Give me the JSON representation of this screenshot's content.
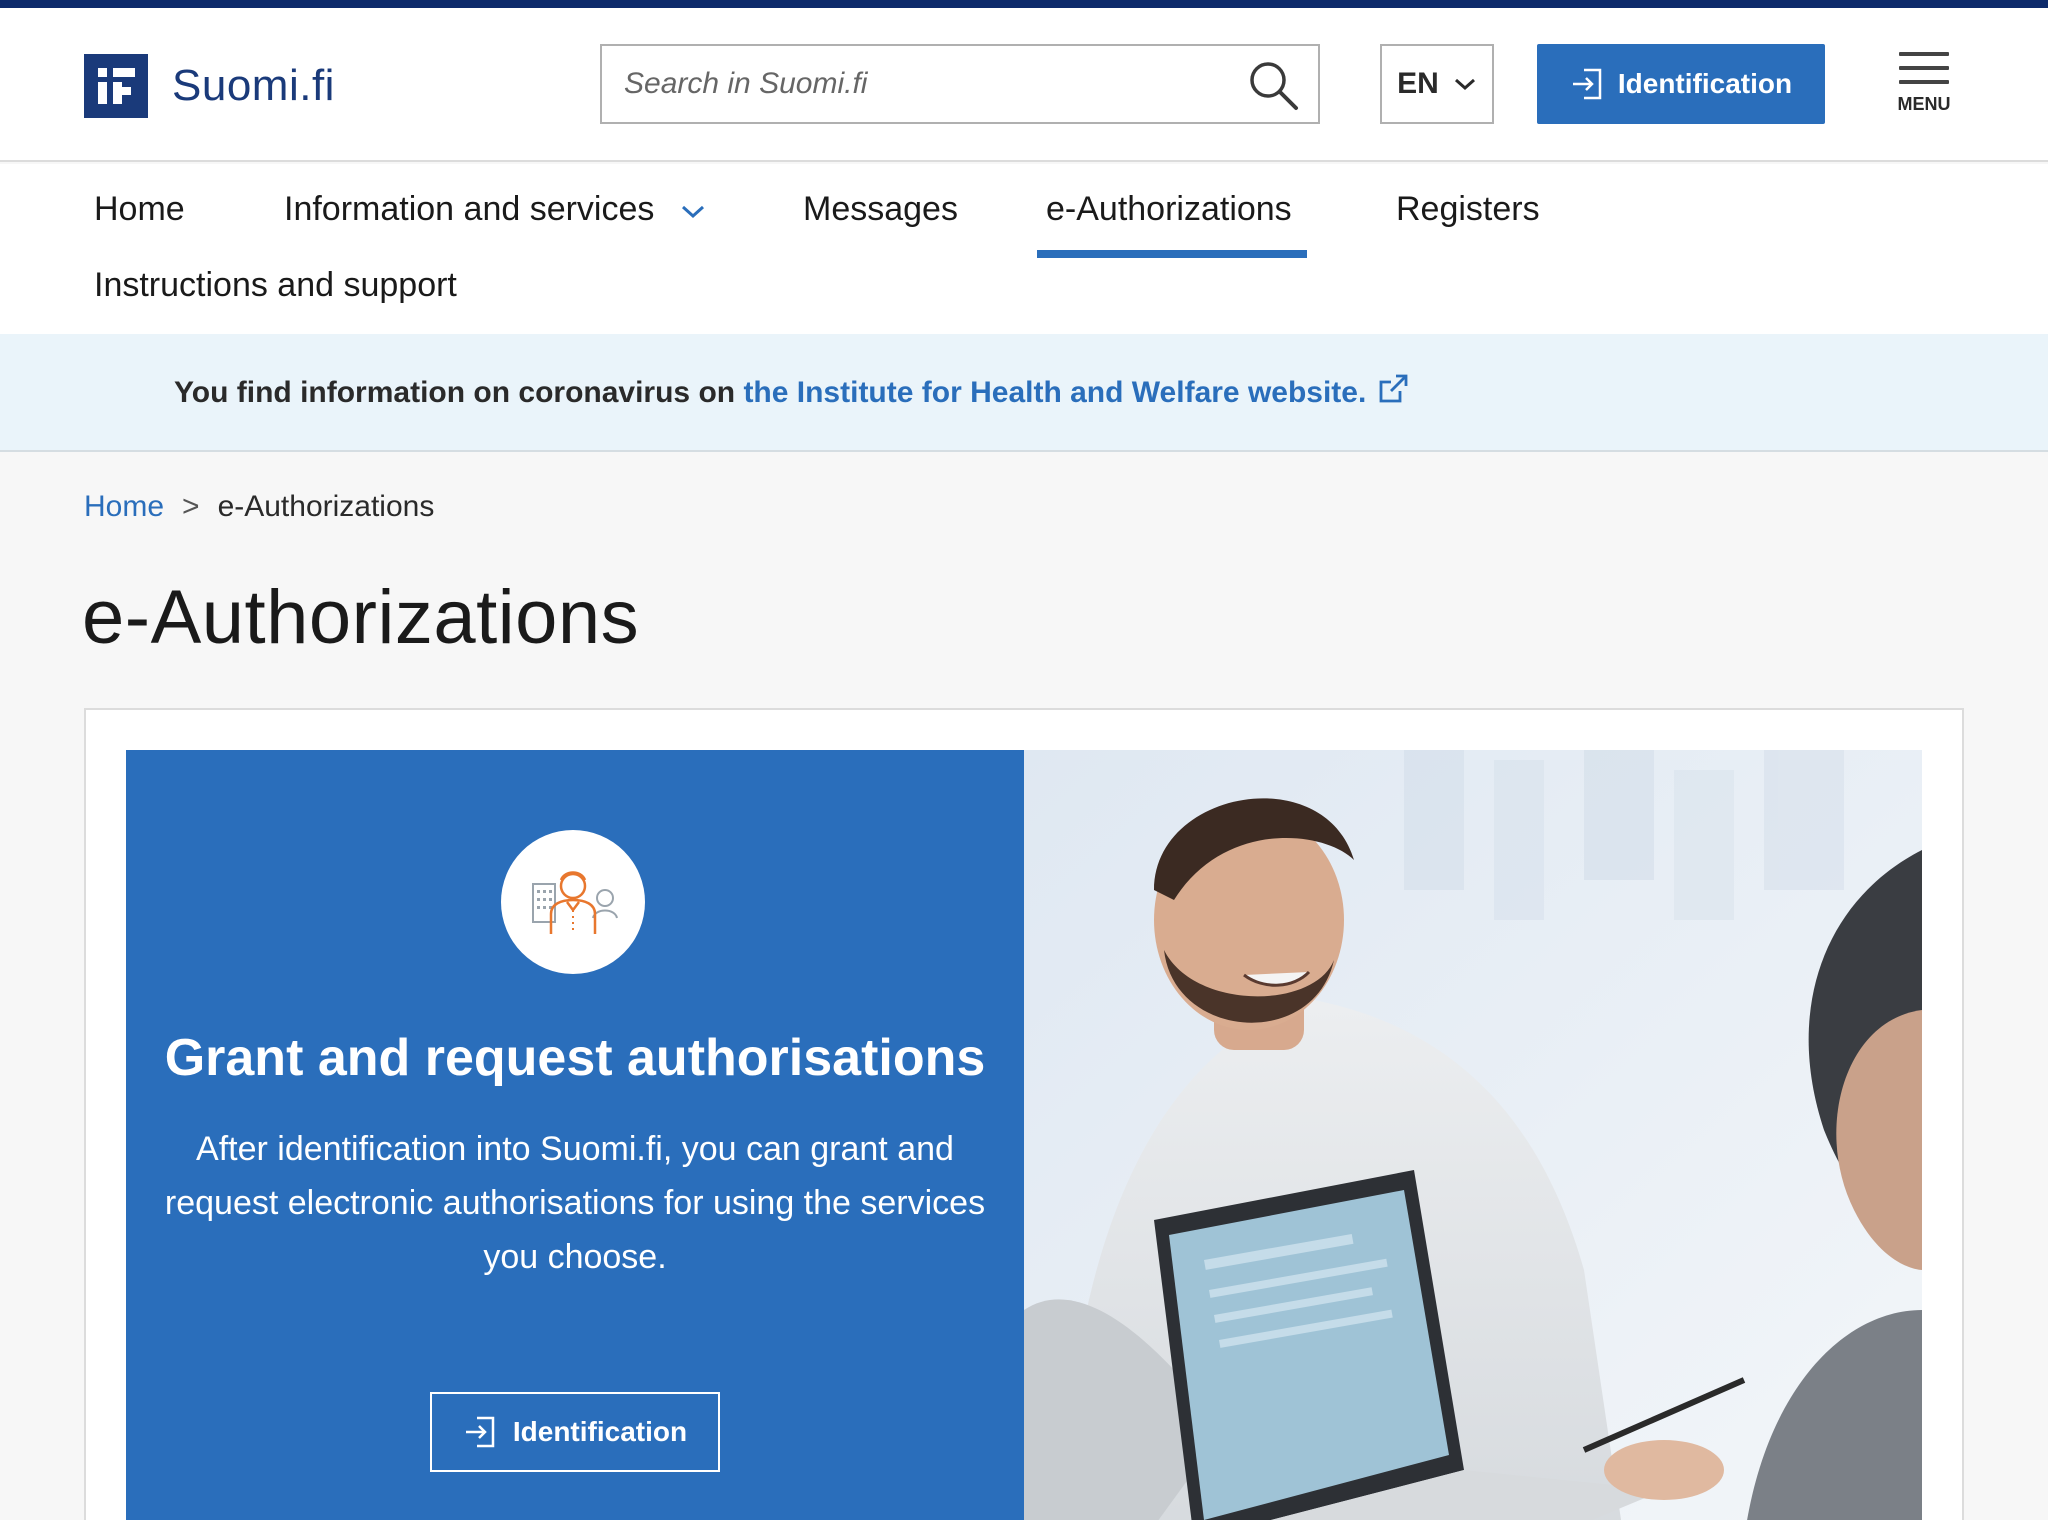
{
  "header": {
    "logo_text": "Suomi.fi",
    "search_placeholder": "Search in Suomi.fi",
    "language": "EN",
    "identification_label": "Identification",
    "menu_label": "MENU"
  },
  "nav": {
    "items": [
      {
        "label": "Home"
      },
      {
        "label": "Information and services"
      },
      {
        "label": "Messages"
      },
      {
        "label": "e-Authorizations"
      },
      {
        "label": "Registers"
      },
      {
        "label": "Instructions and support"
      }
    ],
    "active": "e-Authorizations"
  },
  "notice": {
    "text": "You find information on coronavirus on ",
    "link_text": "the Institute for Health and Welfare website."
  },
  "breadcrumb": {
    "home": "Home",
    "separator": ">",
    "current": "e-Authorizations"
  },
  "page": {
    "title": "e-Authorizations"
  },
  "card": {
    "title": "Grant and request authorisations",
    "description": "After identification into Suomi.fi, you can grant and request electronic authorisations for using the services you choose.",
    "button_label": "Identification"
  },
  "colors": {
    "brand_dark": "#1a3a7a",
    "primary_blue": "#2a6ebb",
    "notice_bg": "#eaf4fa",
    "icon_orange": "#e8772e"
  }
}
